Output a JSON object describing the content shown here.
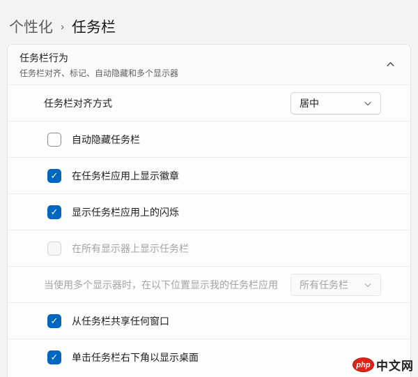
{
  "breadcrumb": {
    "parent": "个性化",
    "separator": "›",
    "current": "任务栏"
  },
  "expander": {
    "title": "任务栏行为",
    "subtitle": "任务栏对齐、标记、自动隐藏和多个显示器",
    "state": "expanded",
    "chevron_icon": "chevron-up"
  },
  "rows": {
    "alignment": {
      "label": "任务栏对齐方式",
      "value": "居中",
      "control": "dropdown",
      "disabled": false
    },
    "auto_hide": {
      "label": "自动隐藏任务栏",
      "checked": false,
      "disabled": false
    },
    "badges": {
      "label": "在任务栏应用上显示徽章",
      "checked": true,
      "disabled": false
    },
    "flashing": {
      "label": "显示任务栏应用上的闪烁",
      "checked": true,
      "disabled": false
    },
    "all_displays": {
      "label": "在所有显示器上显示任务栏",
      "checked": false,
      "disabled": true
    },
    "multi_display": {
      "label": "当使用多个显示器时，在以下位置显示我的任务栏应用",
      "value": "所有任务栏",
      "control": "dropdown",
      "disabled": true
    },
    "share_window": {
      "label": "从任务栏共享任何窗口",
      "checked": true,
      "disabled": false
    },
    "show_desktop": {
      "label": "单击任务栏右下角以显示桌面",
      "checked": true,
      "disabled": false
    }
  },
  "icons": {
    "check": "✓"
  },
  "watermark": {
    "logo_text": "php",
    "site_text": "中文网"
  },
  "colors": {
    "accent": "#0067c0",
    "page_bg": "#f3f3f3",
    "card_bg": "#fdfdfd",
    "disabled_text": "#a3a3a3",
    "watermark_red": "#e32119"
  }
}
